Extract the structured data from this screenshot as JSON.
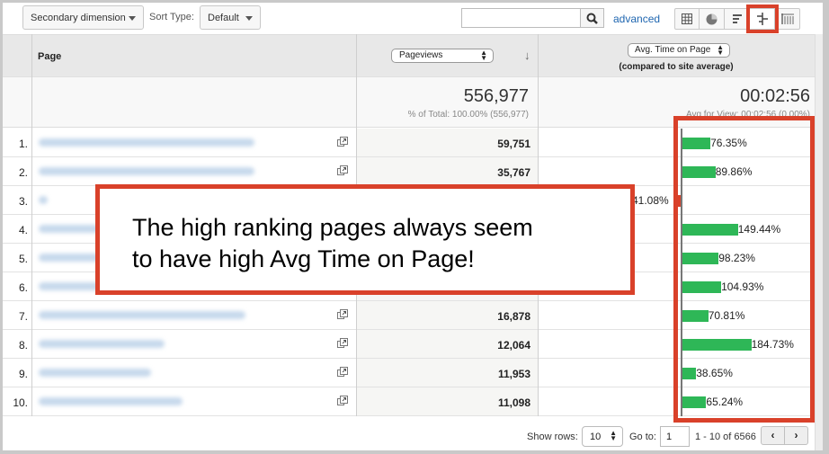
{
  "toolbar": {
    "secondary_dimension_label": "Secondary dimension",
    "sort_type_label": "Sort Type:",
    "sort_type_value": "Default",
    "search_value": "",
    "search_icon": "magnifier-icon",
    "advanced_label": "advanced",
    "view_buttons": [
      {
        "name": "data-table-view",
        "icon": "grid-icon"
      },
      {
        "name": "percentage-view",
        "icon": "pie-icon"
      },
      {
        "name": "performance-view",
        "icon": "bars-icon"
      },
      {
        "name": "comparison-view",
        "icon": "comparison-icon",
        "active": true
      },
      {
        "name": "term-cloud-view",
        "icon": "pivot-icon"
      }
    ]
  },
  "table": {
    "header": {
      "page_label": "Page",
      "metric1_label": "Pageviews",
      "metric2_label": "Avg. Time on Page",
      "metric2_sub": "(compared to site average)",
      "sort_indicator": "↓"
    },
    "totals": {
      "pageviews": "556,977",
      "pageviews_sub": "% of Total: 100.00% (556,977)",
      "avg_time": "00:02:56",
      "avg_time_sub": "Avg for View: 00:02:56 (0.00%)"
    },
    "rows": [
      {
        "index": "1.",
        "pageviews": "59,751",
        "comparison": "76.35%",
        "comparison_value": 76.35
      },
      {
        "index": "2.",
        "pageviews": "35,767",
        "comparison": "89.86%",
        "comparison_value": 89.86
      },
      {
        "index": "3.",
        "pageviews": "",
        "comparison": "41.08%",
        "comparison_value": -41.08
      },
      {
        "index": "4.",
        "pageviews": "",
        "comparison": "149.44%",
        "comparison_value": 149.44
      },
      {
        "index": "5.",
        "pageviews": "",
        "comparison": "98.23%",
        "comparison_value": 98.23
      },
      {
        "index": "6.",
        "pageviews": "",
        "comparison": "104.93%",
        "comparison_value": 104.93
      },
      {
        "index": "7.",
        "pageviews": "16,878",
        "comparison": "70.81%",
        "comparison_value": 70.81
      },
      {
        "index": "8.",
        "pageviews": "12,064",
        "comparison": "184.73%",
        "comparison_value": 184.73
      },
      {
        "index": "9.",
        "pageviews": "11,953",
        "comparison": "38.65%",
        "comparison_value": 38.65
      },
      {
        "index": "10.",
        "pageviews": "11,098",
        "comparison": "65.24%",
        "comparison_value": 65.24
      }
    ]
  },
  "footer": {
    "show_rows_label": "Show rows:",
    "show_rows_value": "10",
    "goto_label": "Go to:",
    "goto_value": "1",
    "range_label": "1 - 10 of 6566",
    "prev_label": "‹",
    "next_label": "›"
  },
  "annotation": {
    "line1": "The high ranking pages always seem",
    "line2": "to have high Avg Time on Page!"
  },
  "colors": {
    "positive_bar": "#2eb757",
    "negative_bar": "#d9412a",
    "annotation_border": "#d9412a",
    "link": "#1f66b0"
  }
}
